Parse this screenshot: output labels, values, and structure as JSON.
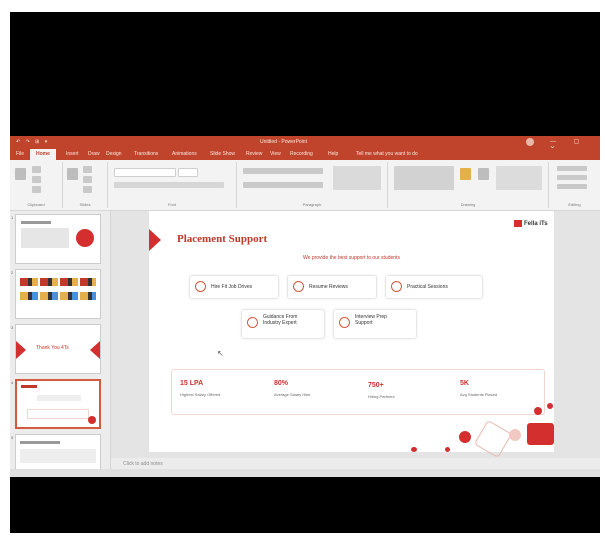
{
  "window": {
    "title": "Untitled - PowerPoint",
    "quick_access": "↶ ↷ ⊞ ▾",
    "user": "",
    "controls": "— ▢ ✕"
  },
  "ribbon_tabs": [
    "File",
    "Home",
    "Insert",
    "Draw",
    "Design",
    "Transitions",
    "Animations",
    "Slide Show",
    "Review",
    "View",
    "Recording",
    "Help",
    "Tell me what you want to do"
  ],
  "ribbon_groups": [
    {
      "label": "Clipboard"
    },
    {
      "label": "Slides"
    },
    {
      "label": "Font"
    },
    {
      "label": "Paragraph"
    },
    {
      "label": "Drawing"
    },
    {
      "label": "Editing"
    }
  ],
  "thumbnails": [
    {
      "num": "1"
    },
    {
      "num": "2"
    },
    {
      "num": "3",
      "text": "Thank You 4Ts"
    },
    {
      "num": "4"
    },
    {
      "num": "5"
    }
  ],
  "slide": {
    "title": "Placement Support",
    "subtitle": "We provide the best support to our students",
    "logo": "Fella iTs",
    "features": [
      {
        "label": "Hire Fit Job Drives"
      },
      {
        "label": "Resume Reviews"
      },
      {
        "label": "Practical Sessions"
      },
      {
        "label": "Guidance From Industry Expert"
      },
      {
        "label": "Interview Prep Support"
      }
    ],
    "stats": [
      {
        "value": "15 LPA",
        "label": "Highest Salary Offered"
      },
      {
        "value": "80%",
        "label": "Average Salary Hike"
      },
      {
        "value": "750+",
        "label": "Hiring Partners"
      },
      {
        "value": "5K",
        "label": "Avg Students Placed"
      }
    ]
  },
  "notes_placeholder": "Click to add notes",
  "colors": {
    "accent": "#c0442b",
    "brand_red": "#d42f2f",
    "text_red": "#c0392b"
  }
}
